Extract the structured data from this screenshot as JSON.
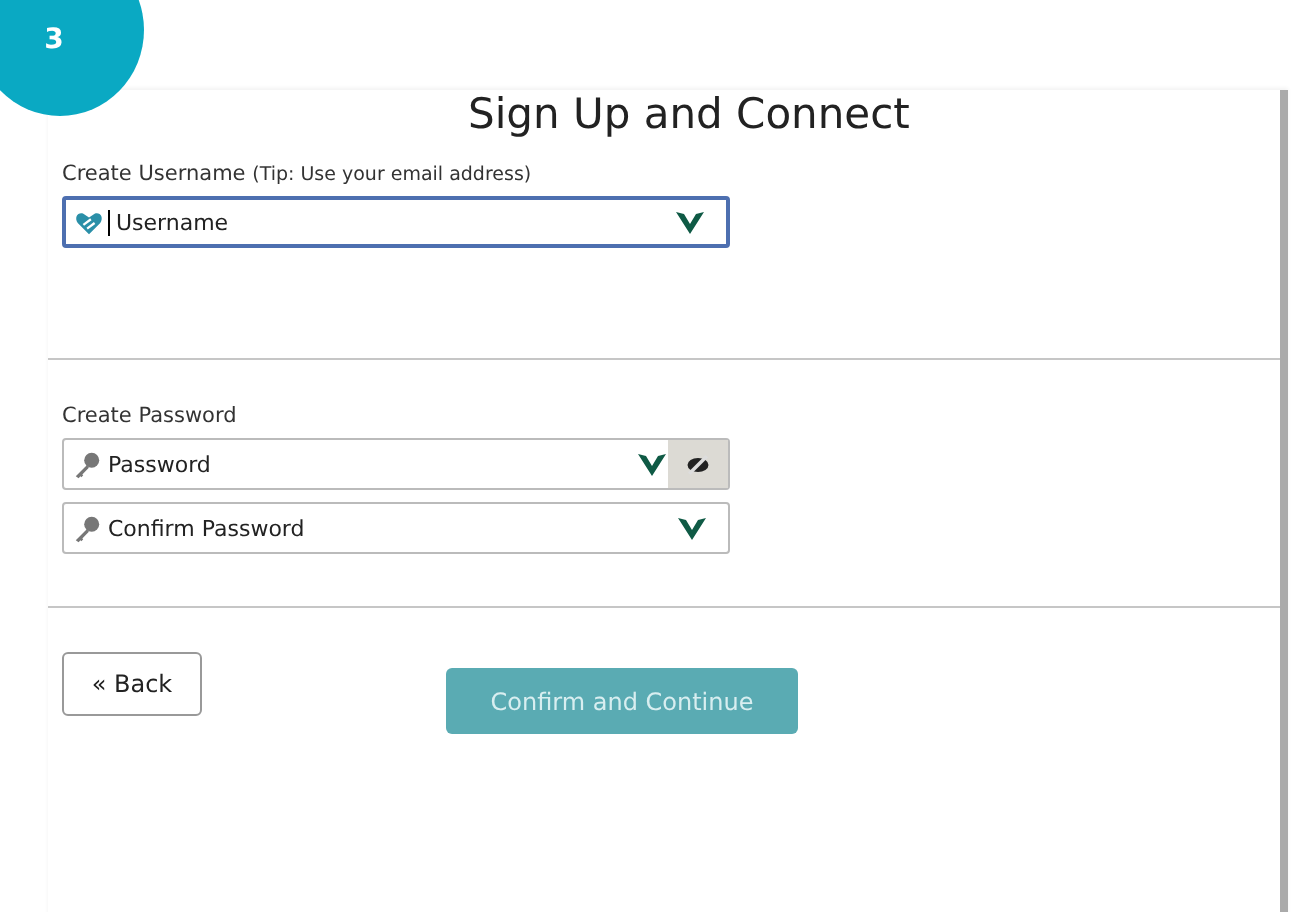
{
  "step": {
    "number": "3"
  },
  "title": "Sign Up and Connect",
  "sections": [
    {
      "label": "Create Username",
      "hint": "(Tip: Use your email address)",
      "fields": [
        {
          "kind": "user",
          "placeholder": "Username",
          "focused": true,
          "reveal_toggle": false
        }
      ]
    },
    {
      "label": "Create Password",
      "fields": [
        {
          "kind": "key",
          "placeholder": "Password",
          "focused": false,
          "reveal_toggle": true
        },
        {
          "kind": "key",
          "placeholder": "Confirm Password",
          "focused": false,
          "reveal_toggle": false
        }
      ]
    }
  ],
  "back_button": {
    "icon": "«",
    "label": "Back"
  },
  "continue_button": {
    "label": "Confirm and Continue",
    "disabled": true
  }
}
